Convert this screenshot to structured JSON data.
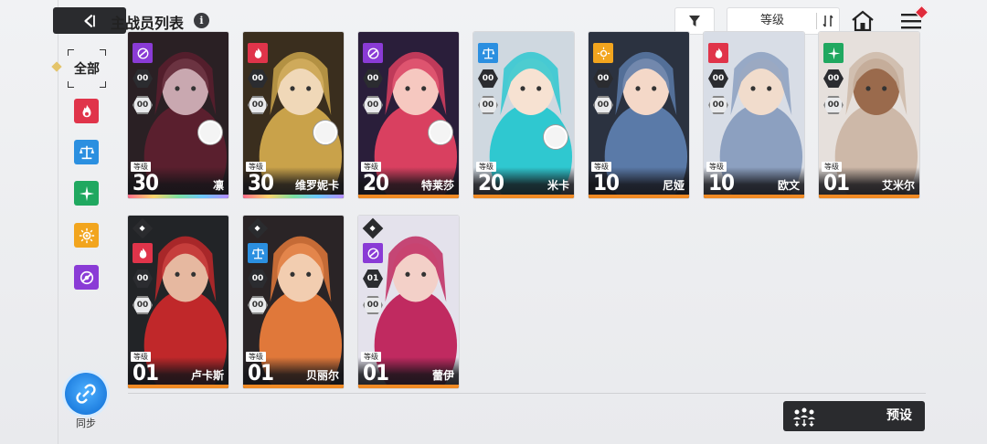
{
  "header": {
    "title": "主战员列表",
    "info_icon": "i",
    "sort_label": "等级"
  },
  "sidebar": {
    "all_label": "全部",
    "filters": [
      {
        "name": "fire",
        "color": "#e0344a"
      },
      {
        "name": "ice",
        "color": "#2b8fe0"
      },
      {
        "name": "wind",
        "color": "#20a860"
      },
      {
        "name": "light",
        "color": "#f2a51e"
      },
      {
        "name": "dark",
        "color": "#8a3bd6"
      }
    ],
    "sync_label": "同步"
  },
  "level_tag": "等级",
  "cards": [
    {
      "name": "凛",
      "level": "30",
      "attribute": "dark",
      "stat1": "00",
      "stat2": "00",
      "bar": "rainbow"
    },
    {
      "name": "维罗妮卡",
      "level": "30",
      "attribute": "fire",
      "stat1": "00",
      "stat2": "00",
      "bar": "rainbow"
    },
    {
      "name": "特莱莎",
      "level": "20",
      "attribute": "dark",
      "stat1": "00",
      "stat2": "00",
      "bar": "orange"
    },
    {
      "name": "米卡",
      "level": "20",
      "attribute": "ice",
      "stat1": "00",
      "stat2": "00",
      "bar": "orange"
    },
    {
      "name": "尼娅",
      "level": "10",
      "attribute": "light",
      "stat1": "00",
      "stat2": "00",
      "bar": "orange"
    },
    {
      "name": "欧文",
      "level": "10",
      "attribute": "fire",
      "stat1": "00",
      "stat2": "00",
      "bar": "orange"
    },
    {
      "name": "艾米尔",
      "level": "01",
      "attribute": "wind",
      "stat1": "00",
      "stat2": "00",
      "bar": "orange"
    },
    {
      "name": "卢卡斯",
      "level": "01",
      "attribute": "fire",
      "stat1": "00",
      "stat2": "00",
      "bar": "orange"
    },
    {
      "name": "贝丽尔",
      "level": "01",
      "attribute": "ice",
      "stat1": "00",
      "stat2": "00",
      "bar": "orange"
    },
    {
      "name": "蕾伊",
      "level": "01",
      "attribute": "dark",
      "stat1": "01",
      "stat2": "00",
      "bar": "orange"
    }
  ],
  "footer": {
    "preset_label": "预设"
  }
}
